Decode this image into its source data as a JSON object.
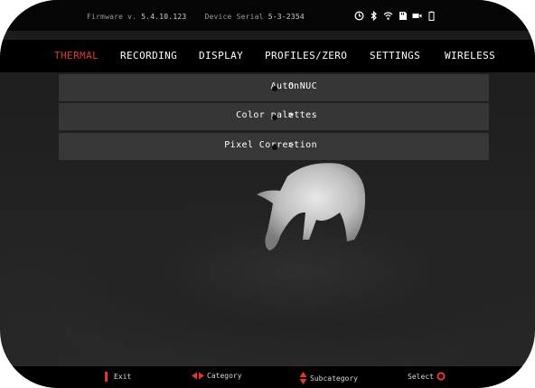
{
  "status_bar": {
    "firmware_label": "Firmware v.",
    "firmware_version": "5.4.10.123",
    "serial_label": "Device Serial",
    "serial_number": "5-3-2354",
    "icons": [
      "auto-rotate-icon",
      "bluetooth-icon",
      "wifi-icon",
      "sd-card-icon",
      "video-record-icon",
      "battery-icon"
    ]
  },
  "menu": {
    "tabs": [
      "THERMAL",
      "RECORDING",
      "DISPLAY",
      "PROFILES/ZERO",
      "SETTINGS",
      "WIRELESS"
    ],
    "active_tab": "THERMAL"
  },
  "items": [
    {
      "label": "Auto NUC",
      "value": "On"
    },
    {
      "label": "Color palettes",
      "value": ">"
    },
    {
      "label": "Pixel Correction",
      "value": ">"
    }
  ],
  "footer": {
    "exit": "Exit",
    "category": "Category",
    "subcategory": "Subcategory",
    "select": "Select"
  },
  "colors": {
    "accent": "#e23636",
    "background": "#000000",
    "row_bg": "#3a3a3a"
  }
}
